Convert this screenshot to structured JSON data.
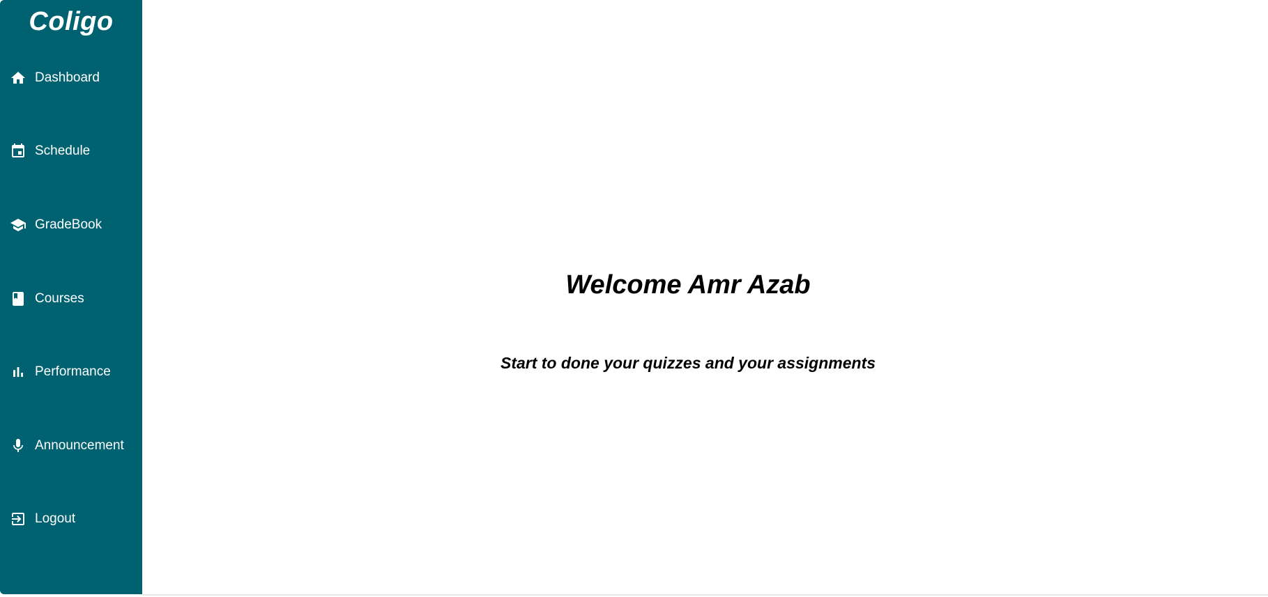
{
  "app": {
    "brand": "Coligo"
  },
  "sidebar": {
    "items": [
      {
        "label": "Dashboard",
        "icon": "home-icon"
      },
      {
        "label": "Schedule",
        "icon": "calendar-icon"
      },
      {
        "label": "GradeBook",
        "icon": "graduation-cap-icon"
      },
      {
        "label": "Courses",
        "icon": "book-icon"
      },
      {
        "label": "Performance",
        "icon": "bar-chart-icon"
      },
      {
        "label": "Announcement",
        "icon": "microphone-icon"
      },
      {
        "label": "Logout",
        "icon": "logout-icon"
      }
    ]
  },
  "main": {
    "title": "Welcome Amr Azab",
    "subtitle": "Start to done your quizzes and your assignments"
  },
  "colors": {
    "sidebar_bg": "#006270",
    "sidebar_text": "#ffffff",
    "main_bg": "#ffffff",
    "main_text": "#000000"
  }
}
